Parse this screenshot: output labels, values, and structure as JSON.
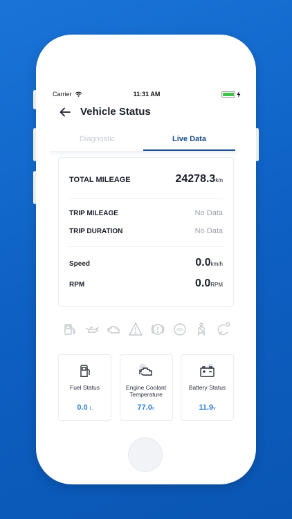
{
  "status_bar": {
    "carrier": "Carrier",
    "time": "11:31 AM"
  },
  "header": {
    "title": "Vehicle Status"
  },
  "tabs": [
    {
      "label": "Diagnostic",
      "active": false
    },
    {
      "label": "Live Data",
      "active": true
    }
  ],
  "live_data": {
    "total_mileage": {
      "label": "TOTAL MILEAGE",
      "value": "24278.3",
      "unit": "km"
    },
    "trip_mileage": {
      "label": "TRIP MILEAGE",
      "value": "No Data"
    },
    "trip_duration": {
      "label": "TRIP DURATION",
      "value": "No Data"
    },
    "speed": {
      "label": "Speed",
      "value": "0.0",
      "unit": "km/h"
    },
    "rpm": {
      "label": "RPM",
      "value": "0.0",
      "unit": "RPM"
    }
  },
  "warning_icons": [
    "fuel-icon",
    "oil-icon",
    "engine-icon",
    "warning-triangle-icon",
    "brake-icon",
    "abs-icon",
    "seatbelt-icon",
    "tire-pressure-icon"
  ],
  "tiles": [
    {
      "label": "Fuel Status",
      "value": "0.0",
      "unit": "L",
      "icon": "fuel-pump-icon"
    },
    {
      "label": "Engine Coolant Temperature",
      "value": "77.0",
      "unit": "c",
      "icon": "engine-coolant-icon"
    },
    {
      "label": "Battery Status",
      "value": "11.9",
      "unit": "v",
      "icon": "battery-icon"
    }
  ],
  "colors": {
    "accent": "#1a4d8f",
    "value_blue": "#2f7ed8",
    "background": "#1467c9",
    "icon_gray": "#c5c9cf"
  }
}
